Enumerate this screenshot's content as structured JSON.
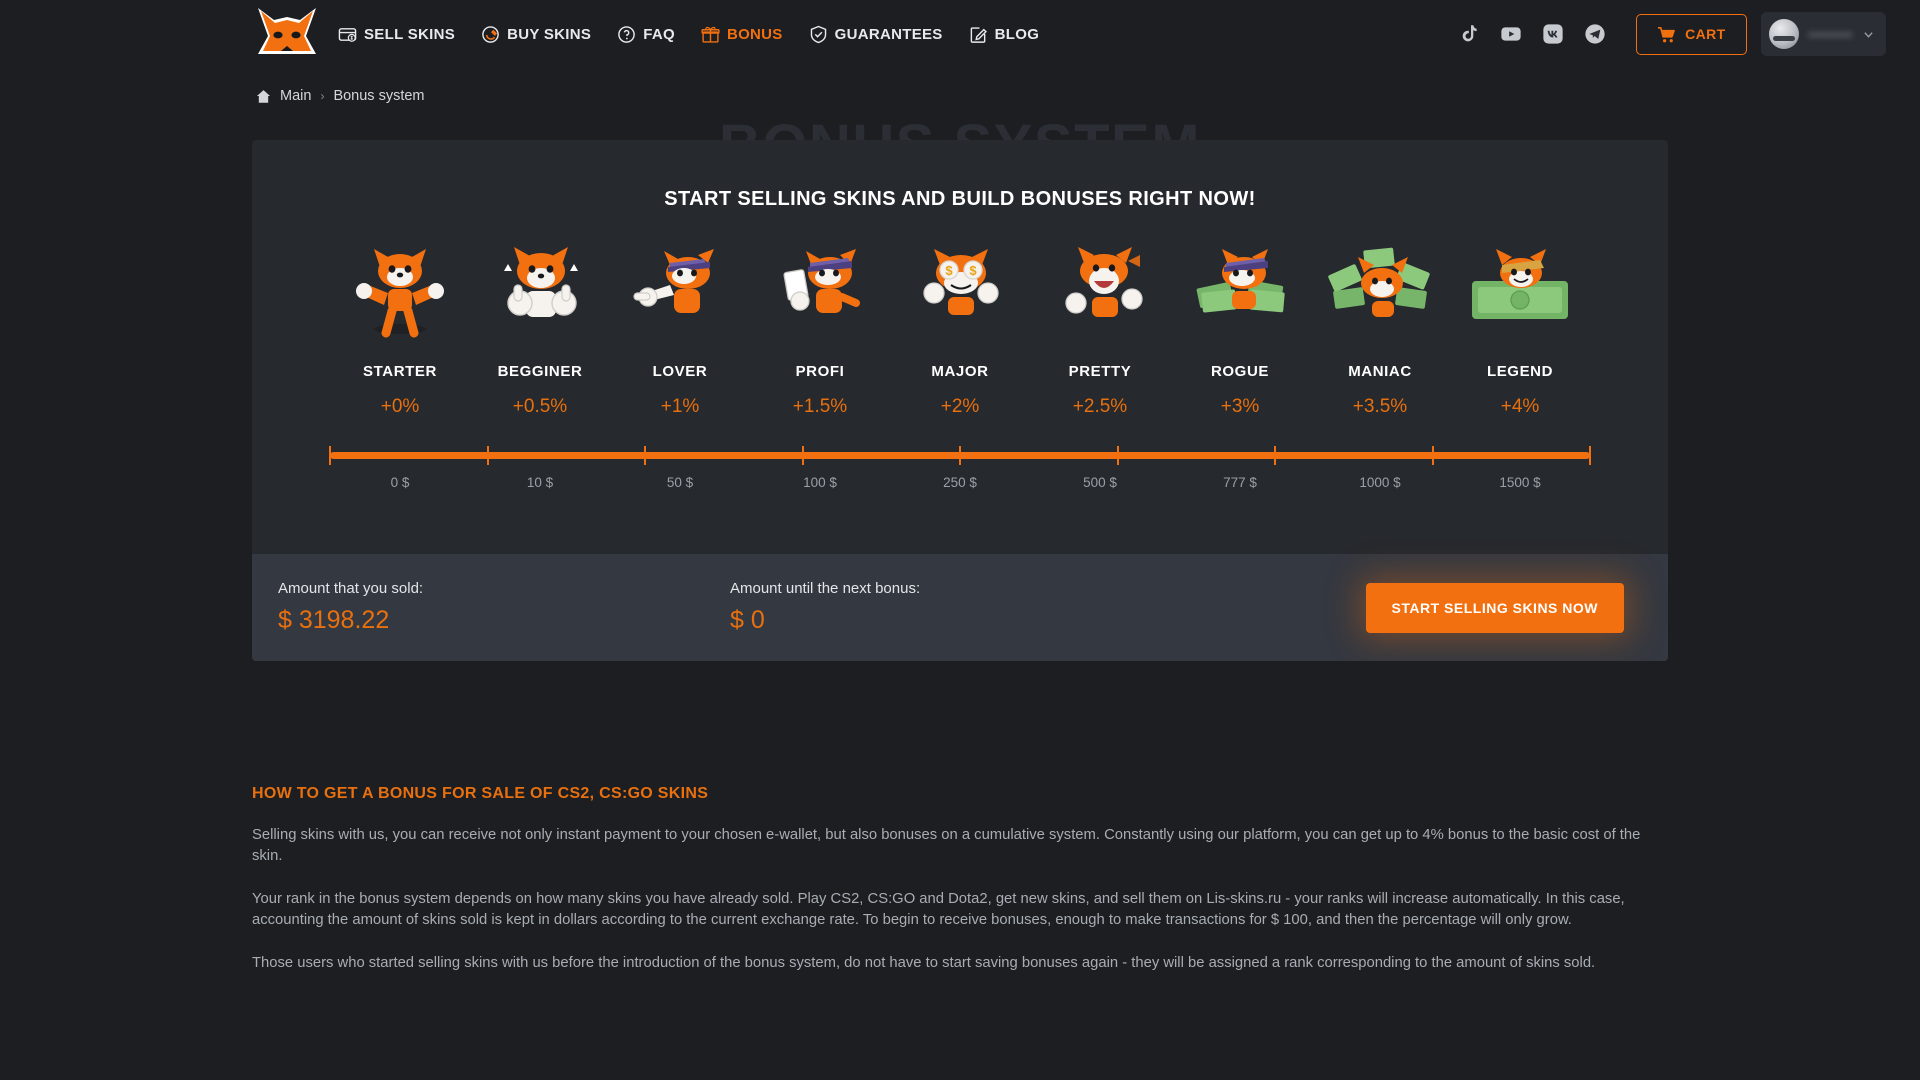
{
  "header": {
    "logo_name": "fox-logo",
    "nav": [
      {
        "label": "SELL SKINS",
        "icon": "sell-skins-icon",
        "active": false
      },
      {
        "label": "BUY SKINS",
        "icon": "buy-skins-icon",
        "active": false
      },
      {
        "label": "FAQ",
        "icon": "faq-icon",
        "active": false
      },
      {
        "label": "BONUS",
        "icon": "bonus-gift-icon",
        "active": true
      },
      {
        "label": "GUARANTEES",
        "icon": "shield-icon",
        "active": false
      },
      {
        "label": "BLOG",
        "icon": "blog-pencil-icon",
        "active": false
      }
    ],
    "socials": [
      {
        "name": "tiktok-icon"
      },
      {
        "name": "youtube-icon"
      },
      {
        "name": "vk-icon"
      },
      {
        "name": "telegram-icon"
      }
    ],
    "cart_label": "CART",
    "profile_name": "••••••••",
    "accent_color": "#f2700f"
  },
  "breadcrumb": {
    "home_icon": "home-icon",
    "items": [
      "Main",
      "Bonus system"
    ],
    "separator": "›"
  },
  "page": {
    "ghost_title": "BONUS SYSTEM"
  },
  "card": {
    "title": "START SELLING SKINS AND BUILD BONUSES RIGHT NOW!",
    "ranks": [
      {
        "name": "STARTER",
        "percent": "+0%",
        "threshold": "0 $",
        "art": "fox-flexing"
      },
      {
        "name": "BEGGINER",
        "percent": "+0.5%",
        "threshold": "10 $",
        "art": "fox-thumbs-up"
      },
      {
        "name": "LOVER",
        "percent": "+1%",
        "threshold": "50 $",
        "art": "fox-pointing"
      },
      {
        "name": "PROFI",
        "percent": "+1.5%",
        "threshold": "100 $",
        "art": "fox-card"
      },
      {
        "name": "MAJOR",
        "percent": "+2%",
        "threshold": "250 $",
        "art": "fox-money-eyes"
      },
      {
        "name": "PRETTY",
        "percent": "+2.5%",
        "threshold": "500 $",
        "art": "fox-laughing"
      },
      {
        "name": "ROGUE",
        "percent": "+3%",
        "threshold": "777 $",
        "art": "fox-cash-stack"
      },
      {
        "name": "MANIAC",
        "percent": "+3.5%",
        "threshold": "1000 $",
        "art": "fox-cash-fan"
      },
      {
        "name": "LEGEND",
        "percent": "+4%",
        "threshold": "1500 $",
        "art": "fox-money-bed"
      }
    ]
  },
  "stats": {
    "sold_label": "Amount that you sold:",
    "sold_value": "$ 3198.22",
    "next_label": "Amount until the next bonus:",
    "next_value": "$ 0",
    "cta_label": "START SELLING SKINS NOW"
  },
  "article": {
    "heading": "HOW TO GET A BONUS FOR SALE OF CS2, CS:GO SKINS",
    "paragraphs": [
      "Selling skins with us, you can receive not only instant payment to your chosen e-wallet, but also bonuses on a cumulative system. Constantly using our platform, you can get up to 4% bonus to the basic cost of the skin.",
      "Your rank in the bonus system depends on how many skins you have already sold. Play CS2, CS:GO and Dota2, get new skins, and sell them on Lis-skins.ru - your ranks will increase automatically. In this case, accounting the amount of skins sold is kept in dollars according to the current exchange rate. To begin to receive bonuses, enough to make transactions for $ 100, and then the percentage will only grow.",
      "Those users who started selling skins with us before the introduction of the bonus system, do not have to start saving bonuses again - they will be assigned a rank corresponding to the amount of skins sold."
    ]
  }
}
